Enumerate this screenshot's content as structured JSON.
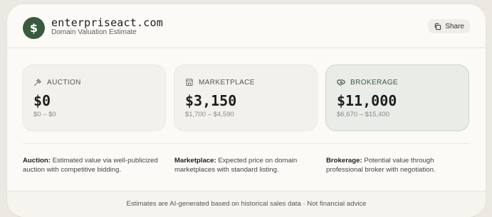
{
  "header": {
    "logo_symbol": "$",
    "domain": "enterpriseact.com",
    "subtitle": "Domain Valuation Estimate",
    "share_label": "Share",
    "brand_color": "#3a5a3d"
  },
  "tiles": [
    {
      "label": "AUCTION",
      "icon": "gavel-icon",
      "value": "$0",
      "range": "$0 – $0"
    },
    {
      "label": "MARKETPLACE",
      "icon": "store-icon",
      "value": "$3,150",
      "range": "$1,700 – $4,590"
    },
    {
      "label": "BROKERAGE",
      "icon": "handshake-icon",
      "value": "$11,000",
      "range": "$6,670 – $15,400",
      "highlighted": true
    }
  ],
  "descriptions": [
    {
      "term": "Auction:",
      "text": " Estimated value via well-publicized auction with competitive bidding."
    },
    {
      "term": "Marketplace:",
      "text": " Expected price on domain marketplaces with standard listing."
    },
    {
      "term": "Brokerage:",
      "text": " Potential value through professional broker with negotiation."
    }
  ],
  "footer": {
    "text": "Estimates are AI-generated based on historical sales data · Not financial advice"
  }
}
